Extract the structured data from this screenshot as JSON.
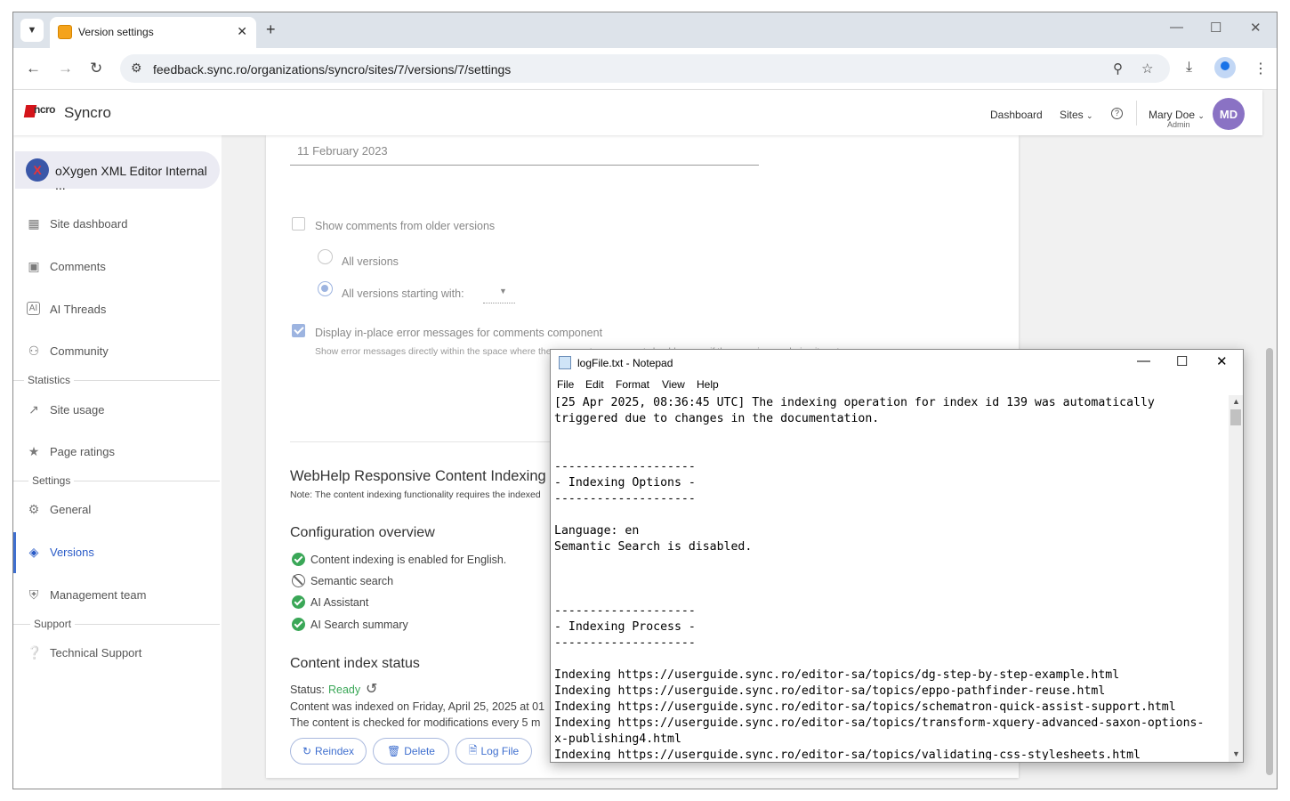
{
  "browser": {
    "tab_title": "Version settings",
    "url": "feedback.sync.ro/organizations/syncro/sites/7/versions/7/settings"
  },
  "header": {
    "logo_text": "ncro",
    "brand": "Syncro",
    "nav": [
      "Dashboard",
      "Sites"
    ],
    "user_name": "Mary Doe",
    "user_role": "Admin",
    "avatar_initials": "MD"
  },
  "sidebar": {
    "site_name": "oXygen XML Editor Internal ...",
    "site_logo": "X",
    "items_top": [
      {
        "label": "Site dashboard",
        "icon": "dashboard-icon"
      },
      {
        "label": "Comments",
        "icon": "comment-icon"
      },
      {
        "label": "AI Threads",
        "icon": "ai-icon"
      },
      {
        "label": "Community",
        "icon": "people-icon"
      }
    ],
    "section_statistics": "Statistics",
    "items_stats": [
      {
        "label": "Site usage",
        "icon": "trending-icon"
      },
      {
        "label": "Page ratings",
        "icon": "star-icon"
      }
    ],
    "section_settings": "Settings",
    "items_settings": [
      {
        "label": "General",
        "icon": "gear-icon"
      },
      {
        "label": "Versions",
        "icon": "layers-icon"
      },
      {
        "label": "Management team",
        "icon": "shield-icon"
      }
    ],
    "section_support": "Support",
    "items_support": [
      {
        "label": "Technical Support",
        "icon": "help-icon"
      }
    ]
  },
  "main": {
    "date_value": "11 February 2023",
    "show_comments_label": "Show comments from older versions",
    "radio_all_versions": "All versions",
    "radio_starting_with": "All versions starting with:",
    "display_errors_label": "Display in-place error messages for comments component",
    "display_errors_help": "Show error messages directly within the space where the comments component should appear if there are issues during its setup.",
    "indexing_title": "WebHelp Responsive Content Indexing",
    "indexing_note": "Note: The content indexing functionality requires the indexed",
    "config_title": "Configuration overview",
    "config_items": [
      {
        "label": "Content indexing is enabled for English.",
        "state": "ok"
      },
      {
        "label": "Semantic search",
        "state": "off"
      },
      {
        "label": "AI Assistant",
        "state": "ok"
      },
      {
        "label": "AI Search summary",
        "state": "ok"
      }
    ],
    "status_title": "Content index status",
    "status_label": "Status:",
    "status_value": "Ready",
    "status_color": "#3aa757",
    "indexed_on": "Content was indexed on Friday, April 25, 2025 at 01",
    "checked_every": "The content is checked for modifications every 5 m",
    "buttons": {
      "reindex": "Reindex",
      "delete": "Delete",
      "logfile": "Log File"
    }
  },
  "notepad": {
    "title": "logFile.txt - Notepad",
    "menu": [
      "File",
      "Edit",
      "Format",
      "View",
      "Help"
    ],
    "content": "[25 Apr 2025, 08:36:45 UTC] The indexing operation for index id 139 was automatically\ntriggered due to changes in the documentation.\n\n\n--------------------\n- Indexing Options -\n--------------------\n\nLanguage: en\nSemantic Search is disabled.\n\n\n\n--------------------\n- Indexing Process -\n--------------------\n\nIndexing https://userguide.sync.ro/editor-sa/topics/dg-step-by-step-example.html\nIndexing https://userguide.sync.ro/editor-sa/topics/eppo-pathfinder-reuse.html\nIndexing https://userguide.sync.ro/editor-sa/topics/schematron-quick-assist-support.html\nIndexing https://userguide.sync.ro/editor-sa/topics/transform-xquery-advanced-saxon-options-\nx-publishing4.html\nIndexing https://userguide.sync.ro/editor-sa/topics/validating-css-stylesheets.html"
  }
}
